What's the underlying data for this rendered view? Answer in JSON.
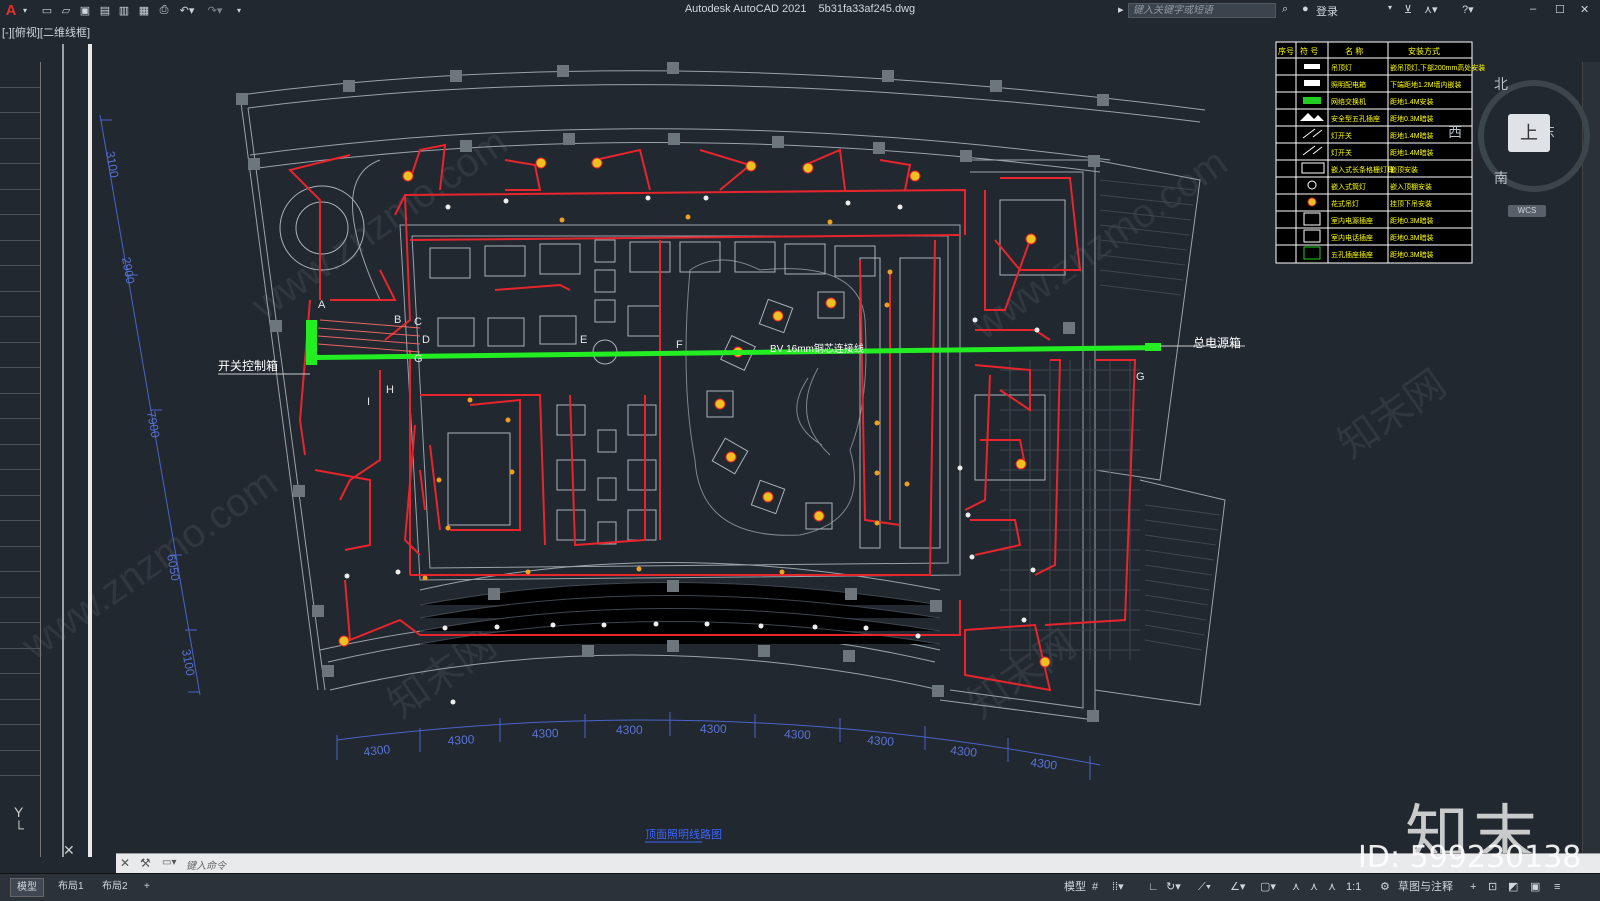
{
  "app": {
    "name": "Autodesk AutoCAD 2021",
    "file": "5b31fa33af245.dwg",
    "search_placeholder": "键入关键字或短语",
    "user_label": "登录",
    "viewport_label": "[-][俯视][二维线框]"
  },
  "drawing": {
    "title": "顶面照明线路图",
    "label_switchbox": "开关控制箱",
    "label_mainbox": "总电源箱",
    "label_wire": "BV 16mm铜芯连接线",
    "point_labels": [
      "A",
      "B",
      "C",
      "D",
      "E",
      "F",
      "G",
      "H",
      "I",
      "G"
    ],
    "dims_left": [
      "3100",
      "2900",
      "7900",
      "6050",
      "3100"
    ],
    "dims_bottom": [
      "4300",
      "4300",
      "4300",
      "4300",
      "4300",
      "4300",
      "4300",
      "4300",
      "4300"
    ]
  },
  "legend": {
    "headers": [
      "序号",
      "符 号",
      "名 称",
      "安装方式"
    ],
    "rows": [
      {
        "name": "吊顶灯",
        "method": "嵌吊顶灯,下部200mm高处安装"
      },
      {
        "name": "照明配电箱",
        "method": "下端距地1.2M墙内嵌装"
      },
      {
        "name": "网络交换机",
        "method": "距地1.4M安装"
      },
      {
        "name": "安全型五孔插座",
        "method": "距地0.3M暗装"
      },
      {
        "name": "灯开关",
        "method": "距地1.4M暗装"
      },
      {
        "name": "灯开关",
        "method": "距地1.4M暗装"
      },
      {
        "name": "嵌入式长条格栅灯具",
        "method": "嵌顶安装"
      },
      {
        "name": "嵌入式筒灯",
        "method": "嵌入顶棚安装"
      },
      {
        "name": "花式吊灯",
        "method": "挂顶下吊安装"
      },
      {
        "name": "室内电源插座",
        "method": "距地0.3M暗装"
      },
      {
        "name": "室内电话插座",
        "method": "距地0.3M暗装"
      },
      {
        "name": "五孔插座插座",
        "method": "距地0.3M暗装"
      }
    ]
  },
  "compass": {
    "north": "北",
    "south": "南",
    "east": "东",
    "west": "西",
    "face": "上",
    "wcs": "WCS"
  },
  "command": {
    "placeholder": "键入命令"
  },
  "layout_tabs": [
    "模型",
    "布局1",
    "布局2",
    "+"
  ],
  "status": {
    "model": "模型",
    "scale": "1:1",
    "workspace": "草图与注释"
  },
  "watermark": {
    "brand": "知末",
    "id": "ID: 599230138",
    "site": "www.znzmo.com",
    "cn": "知末网"
  },
  "colors": {
    "background": "#212830",
    "wire_red": "#e8252c",
    "wire_green": "#22ee22",
    "dim_blue": "#4a64c8",
    "lamp_yellow": "#f0c020",
    "legend_text": "#ffff00"
  }
}
